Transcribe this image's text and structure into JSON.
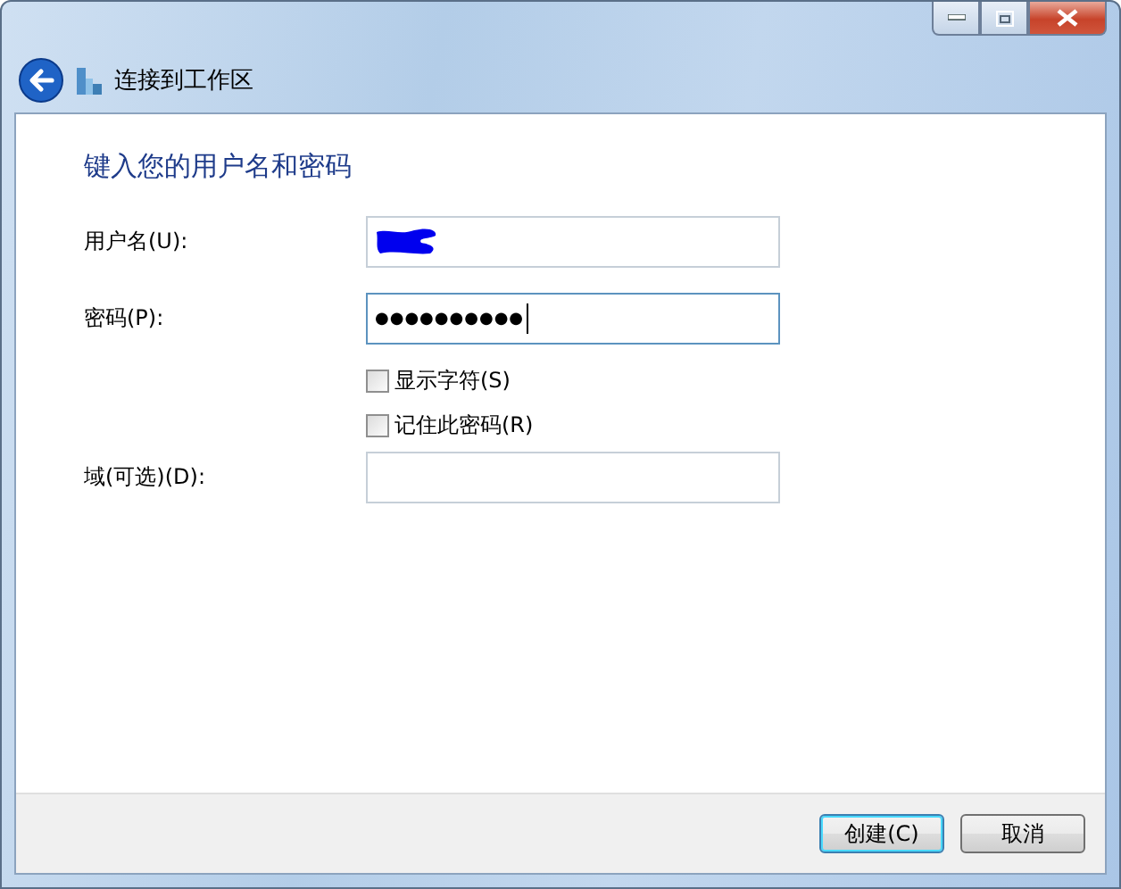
{
  "window": {
    "title": "连接到工作区",
    "controls": [
      {
        "kind": "minimize"
      },
      {
        "kind": "maximize"
      },
      {
        "kind": "close"
      }
    ]
  },
  "heading": "键入您的用户名和密码",
  "fields": [
    {
      "kind": "redacted",
      "label": "用户名(U):",
      "focused": false
    },
    {
      "kind": "text",
      "label": "密码(P):",
      "value": "●●●●●●●●●●",
      "focused": true
    },
    {
      "kind": "checkbox",
      "label": "显示字符(S)",
      "checked": false
    },
    {
      "kind": "checkbox",
      "label": "记住此密码(R)",
      "checked": false
    },
    {
      "kind": "empty",
      "label": "域(可选)(D):",
      "focused": false
    }
  ],
  "buttons": [
    {
      "label": "创建(C)",
      "default": true
    },
    {
      "label": "取消",
      "default": false
    }
  ]
}
